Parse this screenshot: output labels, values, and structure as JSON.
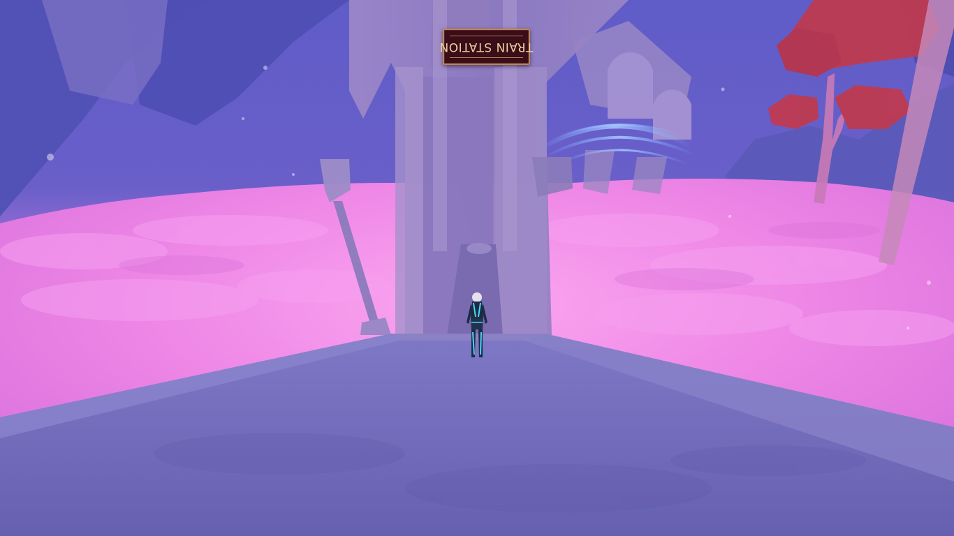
{
  "scene": {
    "sign": {
      "text": "TRAIN STATION",
      "mirrored": true
    },
    "colors": {
      "sky": "#5a56b8",
      "clouds": "#ee86e6",
      "stone": "#7a73c2",
      "tree_leaves": "#c13a4e",
      "sign_background": "#3a0d18",
      "sign_text": "#e9cfa2",
      "player_glow": "#49d6f4"
    }
  }
}
